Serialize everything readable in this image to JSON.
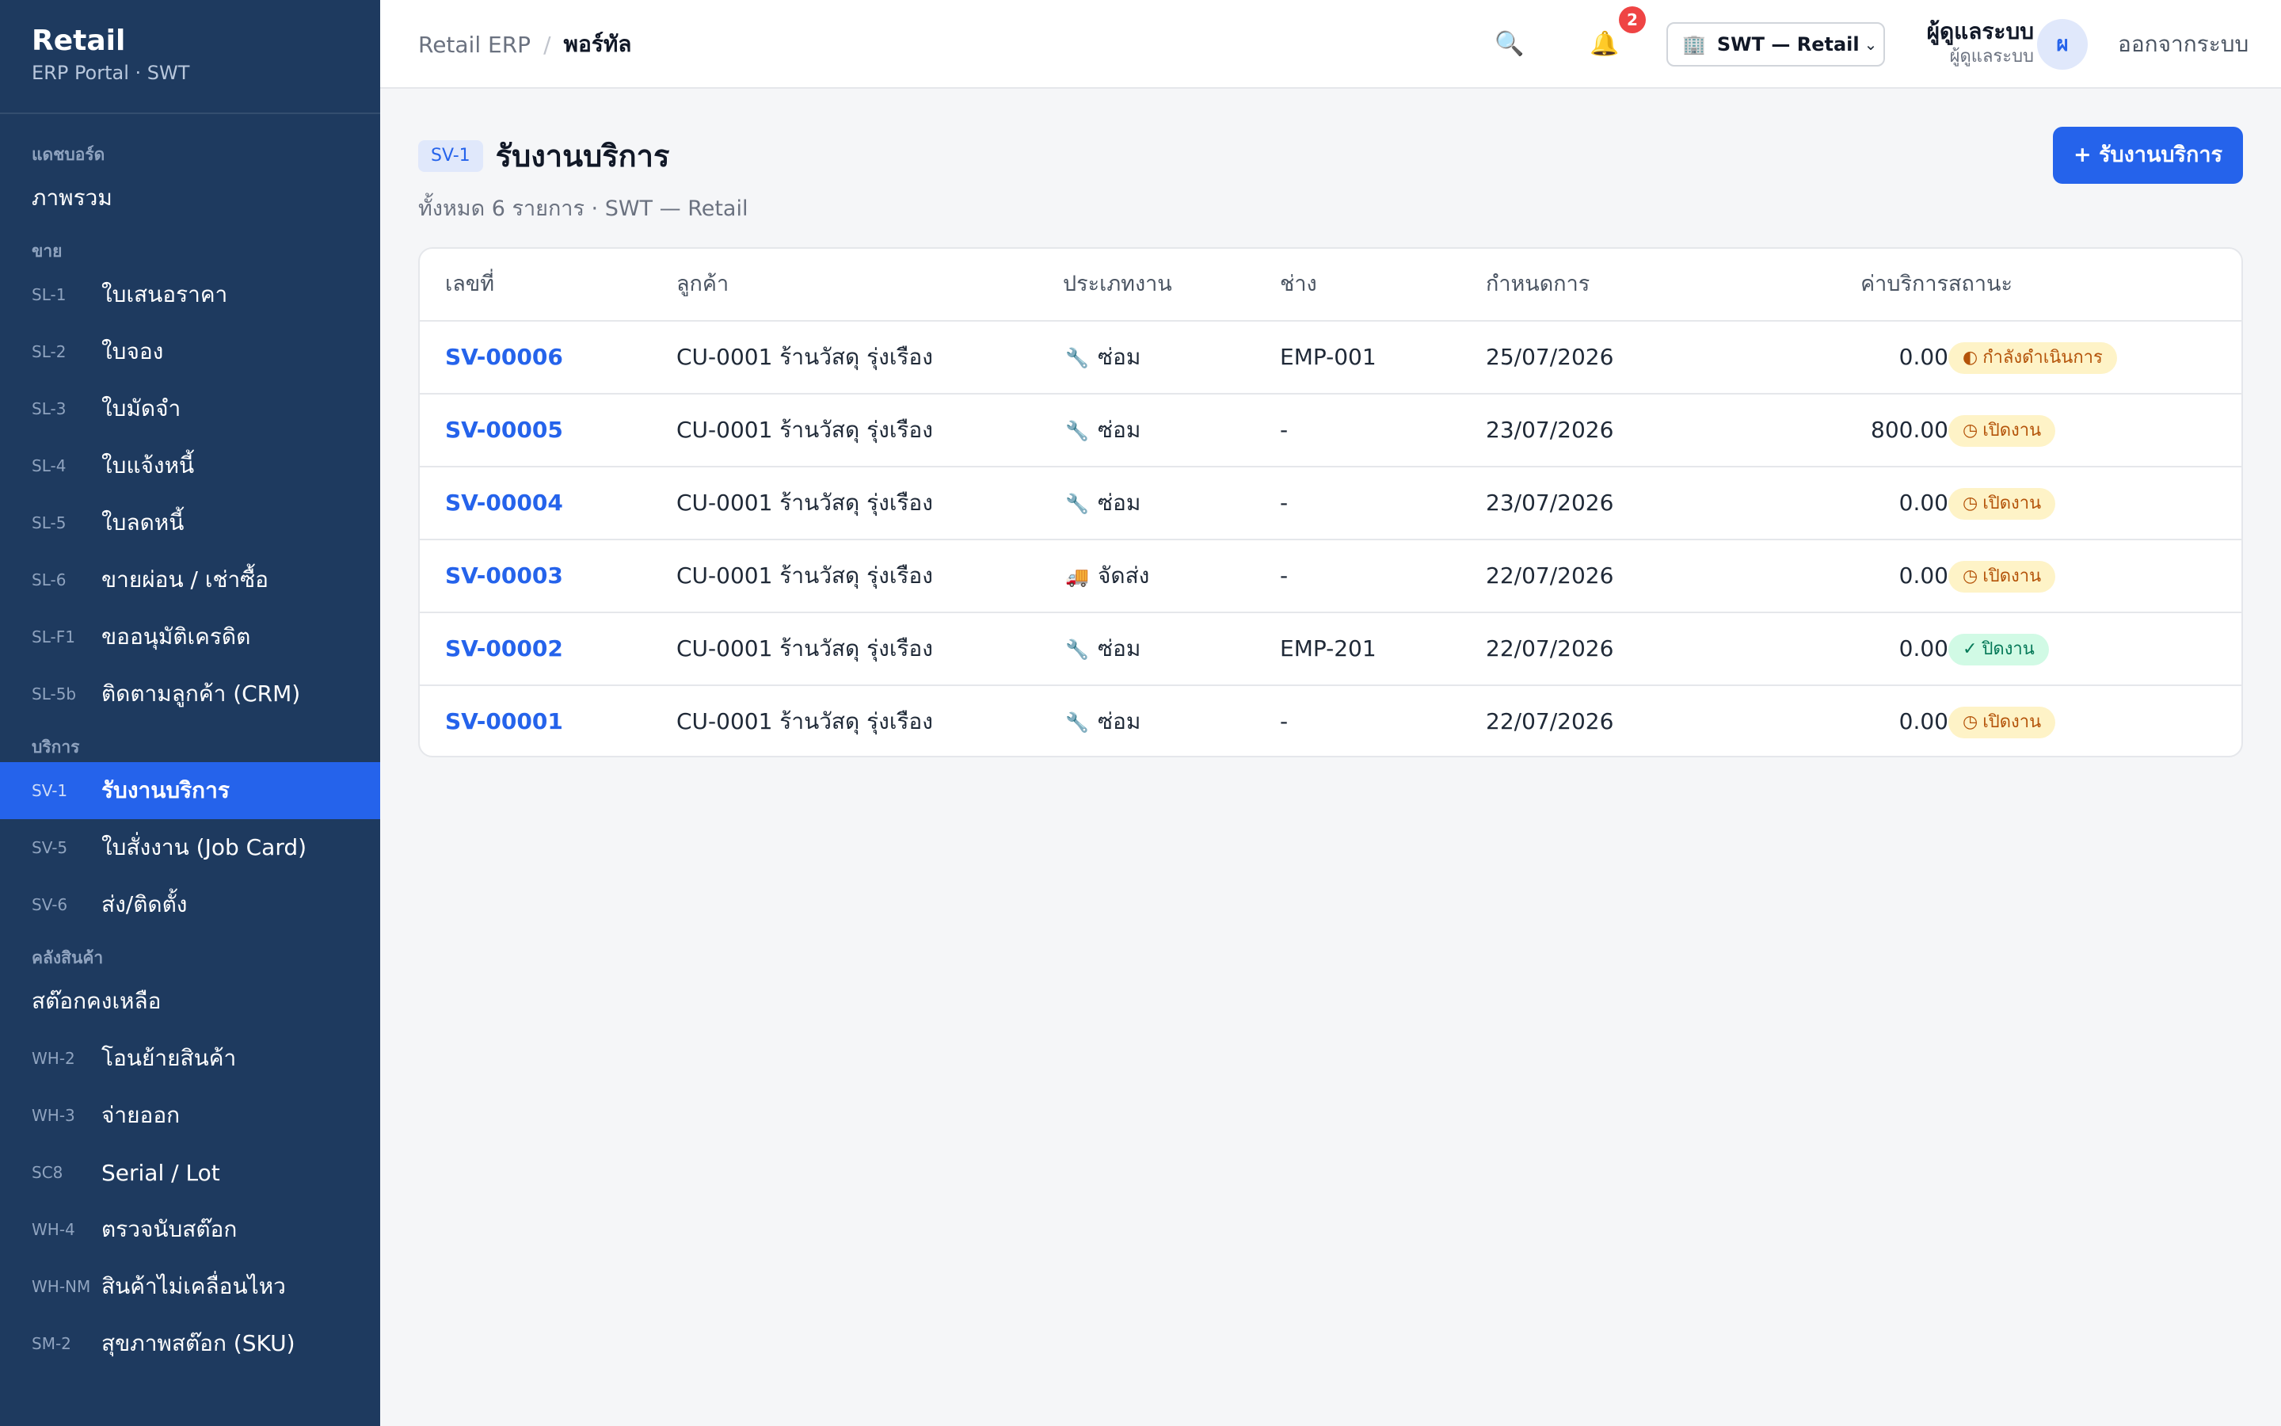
{
  "brand": {
    "title": "Retail",
    "subtitle": "ERP Portal · SWT"
  },
  "sidebar": {
    "groups": [
      {
        "label": "แดชบอร์ด",
        "items": [
          {
            "code": "",
            "label": "ภาพรวม"
          }
        ]
      },
      {
        "label": "ขาย",
        "items": [
          {
            "code": "SL-1",
            "label": "ใบเสนอราคา"
          },
          {
            "code": "SL-2",
            "label": "ใบจอง"
          },
          {
            "code": "SL-3",
            "label": "ใบมัดจำ"
          },
          {
            "code": "SL-4",
            "label": "ใบแจ้งหนี้"
          },
          {
            "code": "SL-5",
            "label": "ใบลดหนี้"
          },
          {
            "code": "SL-6",
            "label": "ขายผ่อน / เช่าซื้อ"
          },
          {
            "code": "SL-F1",
            "label": "ขออนุมัติเครดิต"
          },
          {
            "code": "SL-5b",
            "label": "ติดตามลูกค้า (CRM)"
          }
        ]
      },
      {
        "label": "บริการ",
        "items": [
          {
            "code": "SV-1",
            "label": "รับงานบริการ",
            "active": true
          },
          {
            "code": "SV-5",
            "label": "ใบสั่งงาน (Job Card)"
          },
          {
            "code": "SV-6",
            "label": "ส่ง/ติดตั้ง"
          }
        ]
      },
      {
        "label": "คลังสินค้า",
        "items": [
          {
            "code": "",
            "label": "สต๊อกคงเหลือ"
          },
          {
            "code": "WH-2",
            "label": "โอนย้ายสินค้า"
          },
          {
            "code": "WH-3",
            "label": "จ่ายออก"
          },
          {
            "code": "SC8",
            "label": "Serial / Lot"
          },
          {
            "code": "WH-4",
            "label": "ตรวจนับสต๊อก"
          },
          {
            "code": "WH-NM",
            "label": "สินค้าไม่เคลื่อนไหว"
          },
          {
            "code": "SM-2",
            "label": "สุขภาพสต๊อก (SKU)"
          }
        ]
      }
    ]
  },
  "topbar": {
    "breadcrumb_root": "Retail ERP",
    "breadcrumb_sep": "/",
    "breadcrumb_current": "พอร์ทัล",
    "notification_count": "2",
    "org_select": "SWT — Retail",
    "user_name": "ผู้ดูแลระบบ",
    "user_role": "ผู้ดูแลระบบ",
    "avatar_initial": "ผ",
    "logout": "ออกจากระบบ",
    "icons": {
      "search": "search-icon",
      "bell": "bell-icon",
      "building": "building-icon",
      "chevron": "chevron-down-icon"
    }
  },
  "page": {
    "code": "SV-1",
    "title": "รับงานบริการ",
    "subtitle": "ทั้งหมด 6 รายการ · SWT — Retail",
    "new_button": "+ รับงานบริการ"
  },
  "table": {
    "headers": {
      "no": "เลขที่",
      "customer": "ลูกค้า",
      "type": "ประเภทงาน",
      "tech": "ช่าง",
      "due": "กำหนดการ",
      "fee": "ค่าบริการ",
      "status": "สถานะ"
    },
    "rows": [
      {
        "no": "SV-00006",
        "customer": "CU-0001 ร้านวัสดุ รุ่งเรือง",
        "type_icon": "🔧",
        "type": "ซ่อม",
        "tech": "EMP-001",
        "due": "25/07/2026",
        "fee": "0.00",
        "status_icon": "◐",
        "status": "กำลังดำเนินการ",
        "status_kind": "progress"
      },
      {
        "no": "SV-00005",
        "customer": "CU-0001 ร้านวัสดุ รุ่งเรือง",
        "type_icon": "🔧",
        "type": "ซ่อม",
        "tech": "-",
        "due": "23/07/2026",
        "fee": "800.00",
        "status_icon": "◷",
        "status": "เปิดงาน",
        "status_kind": "open"
      },
      {
        "no": "SV-00004",
        "customer": "CU-0001 ร้านวัสดุ รุ่งเรือง",
        "type_icon": "🔧",
        "type": "ซ่อม",
        "tech": "-",
        "due": "23/07/2026",
        "fee": "0.00",
        "status_icon": "◷",
        "status": "เปิดงาน",
        "status_kind": "open"
      },
      {
        "no": "SV-00003",
        "customer": "CU-0001 ร้านวัสดุ รุ่งเรือง",
        "type_icon": "🚚",
        "type": "จัดส่ง",
        "tech": "-",
        "due": "22/07/2026",
        "fee": "0.00",
        "status_icon": "◷",
        "status": "เปิดงาน",
        "status_kind": "open"
      },
      {
        "no": "SV-00002",
        "customer": "CU-0001 ร้านวัสดุ รุ่งเรือง",
        "type_icon": "🔧",
        "type": "ซ่อม",
        "tech": "EMP-201",
        "due": "22/07/2026",
        "fee": "0.00",
        "status_icon": "✓",
        "status": "ปิดงาน",
        "status_kind": "closed"
      },
      {
        "no": "SV-00001",
        "customer": "CU-0001 ร้านวัสดุ รุ่งเรือง",
        "type_icon": "🔧",
        "type": "ซ่อม",
        "tech": "-",
        "due": "22/07/2026",
        "fee": "0.00",
        "status_icon": "◷",
        "status": "เปิดงาน",
        "status_kind": "open"
      }
    ]
  },
  "colors": {
    "sidebar_bg": "#1e3a5f",
    "accent": "#2563eb",
    "open_status": "#b45309",
    "closed_status": "#047857",
    "badge": "#ef4444"
  }
}
